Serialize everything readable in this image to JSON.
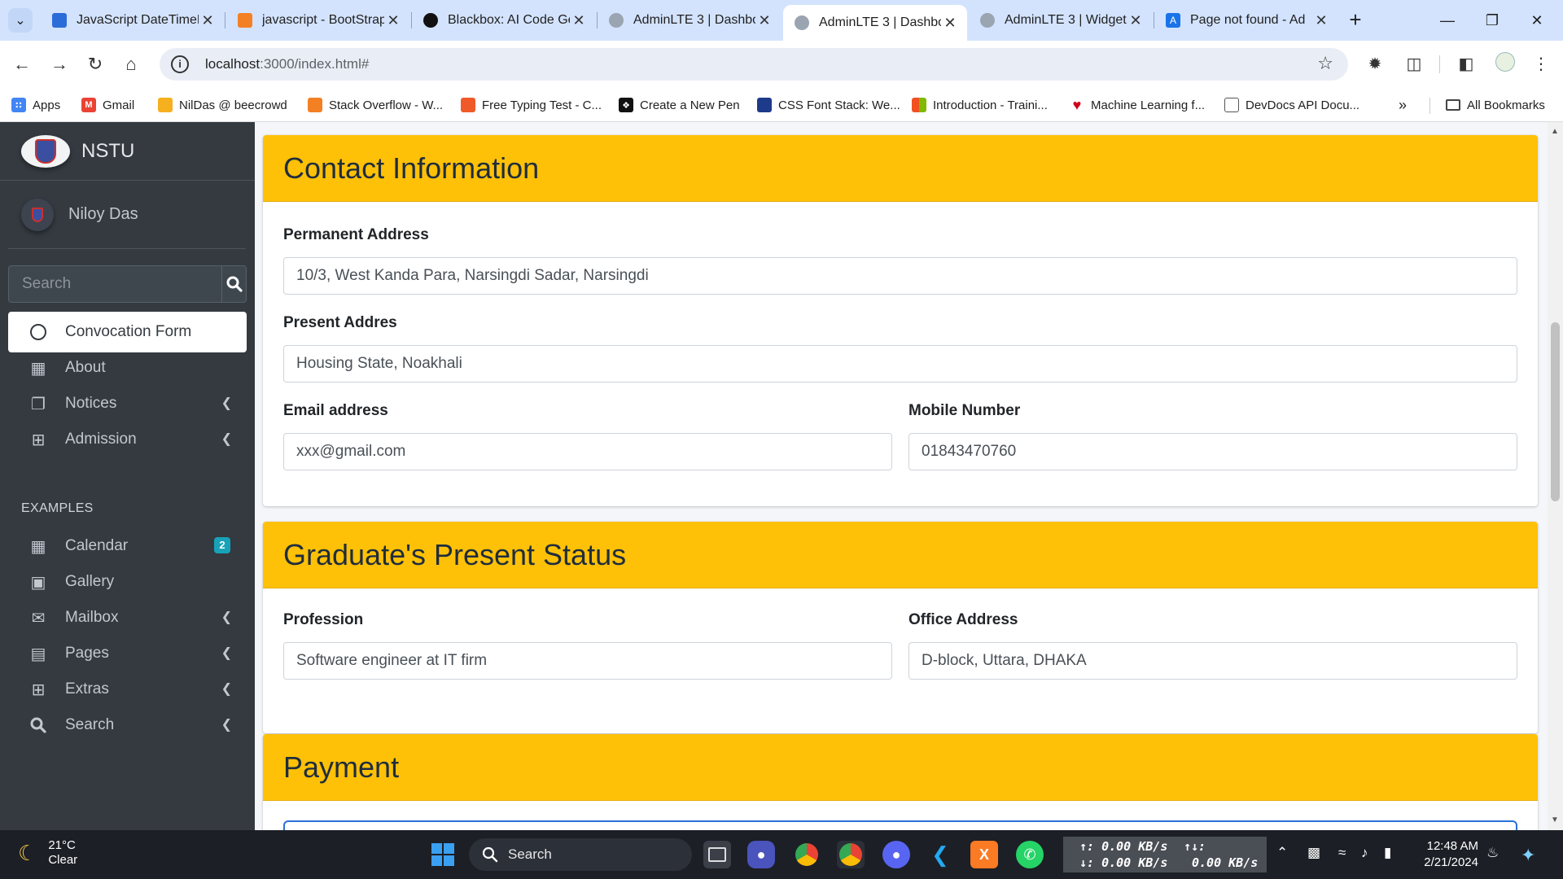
{
  "browser": {
    "tabs": [
      {
        "title": "JavaScript DateTimeP",
        "favicon_color": "#2b6cd8"
      },
      {
        "title": "javascript - BootStrap",
        "favicon_color": "#f48024"
      },
      {
        "title": "Blackbox: AI Code Ge",
        "favicon_color": "#111111"
      },
      {
        "title": "AdminLTE 3 | Dashbo",
        "favicon_color": "#9aa5b1"
      },
      {
        "title": "AdminLTE 3 | Dashbo",
        "favicon_color": "#9aa5b1"
      },
      {
        "title": "AdminLTE 3 | Widget",
        "favicon_color": "#9aa5b1"
      },
      {
        "title": "Page not found - Ad",
        "favicon_color": "#1a73e8"
      }
    ],
    "url_host": "localhost",
    "url_rest": ":3000/index.html#",
    "bookmarks": [
      {
        "label": "Apps",
        "icon_color": "#4285f4"
      },
      {
        "label": "Gmail",
        "icon_color": "#ea4335"
      },
      {
        "label": "NilDas @ beecrowd",
        "icon_color": "#f6b01e"
      },
      {
        "label": "Stack Overflow - W...",
        "icon_color": "#f48024"
      },
      {
        "label": "Free Typing Test - C...",
        "icon_color": "#f05a28"
      },
      {
        "label": "Create a New Pen",
        "icon_color": "#111111"
      },
      {
        "label": "CSS Font Stack: We...",
        "icon_color": "#1e3a8a"
      },
      {
        "label": "Introduction - Traini...",
        "icon_color": "#00a4ef"
      },
      {
        "label": "Machine Learning f...",
        "icon_color": "#d0021b"
      },
      {
        "label": "DevDocs API Docu...",
        "icon_color": "#555555"
      }
    ],
    "all_bookmarks": "All Bookmarks"
  },
  "sidebar": {
    "brand": "NSTU",
    "user": "Niloy Das",
    "search_placeholder": "Search",
    "header_examples": "EXAMPLES",
    "items": [
      {
        "label": "Convocation Form",
        "icon": "circle-icon"
      },
      {
        "label": "About",
        "icon": "th-icon"
      },
      {
        "label": "Notices",
        "icon": "copy-icon"
      },
      {
        "label": "Admission",
        "icon": "table-icon"
      },
      {
        "label": "Calendar",
        "icon": "calendar-icon",
        "badge": "2"
      },
      {
        "label": "Gallery",
        "icon": "image-icon"
      },
      {
        "label": "Mailbox",
        "icon": "envelope-icon"
      },
      {
        "label": "Pages",
        "icon": "book-icon"
      },
      {
        "label": "Extras",
        "icon": "plus-square-icon"
      },
      {
        "label": "Search",
        "icon": "search-icon"
      }
    ]
  },
  "contact": {
    "title": "Contact Information",
    "permanent_label": "Permanent Address",
    "permanent_value": "10/3, West Kanda Para, Narsingdi Sadar, Narsingdi",
    "present_label": "Present Addres",
    "present_value": "Housing State, Noakhali",
    "email_label": "Email address",
    "email_value": "xxx@gmail.com",
    "mobile_label": "Mobile Number",
    "mobile_value": "01843470760"
  },
  "status": {
    "title": "Graduate's Present Status",
    "profession_label": "Profession",
    "profession_value": "Software engineer at IT firm",
    "office_label": "Office Address",
    "office_value": "D-block, Uttara, DHAKA"
  },
  "payment": {
    "title": "Payment"
  },
  "taskbar": {
    "temperature": "21°C",
    "weather": "Clear",
    "search": "Search",
    "net_up": "0.00 KB/s",
    "net_down": "0.00 KB/s",
    "net_total": "0.00 KB/s",
    "time": "12:48 AM",
    "date": "2/21/2024"
  },
  "colors": {
    "card_header": "#ffc107",
    "sidebar_bg": "#343a40",
    "badge": "#17a2b8"
  }
}
